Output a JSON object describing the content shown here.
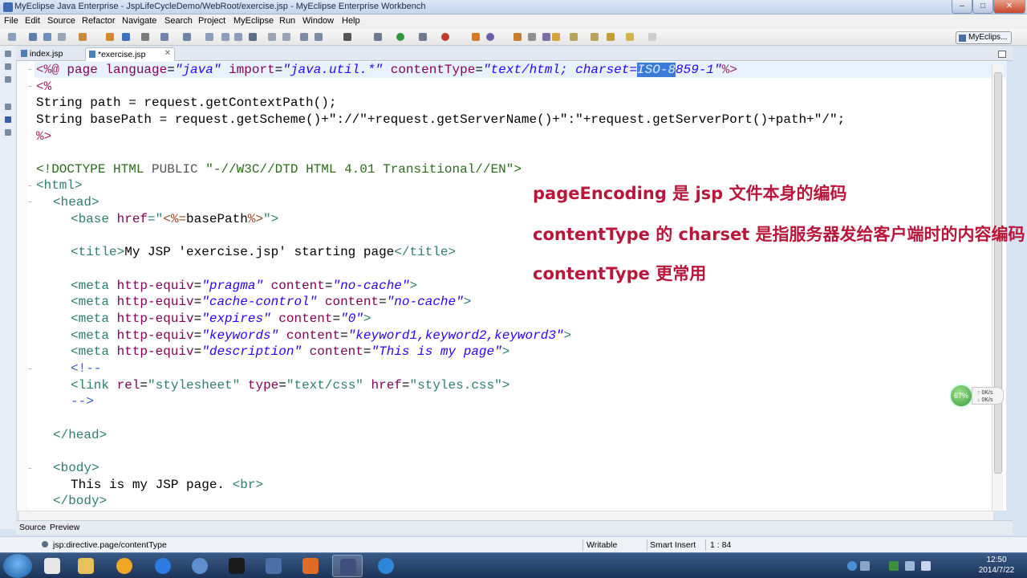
{
  "window": {
    "title": "MyEclipse Java Enterprise - JspLifeCycleDemo/WebRoot/exercise.jsp - MyEclipse Enterprise Workbench"
  },
  "menu": [
    "File",
    "Edit",
    "Source",
    "Refactor",
    "Navigate",
    "Search",
    "Project",
    "MyEclipse",
    "Run",
    "Window",
    "Help"
  ],
  "perspective": {
    "label": "MyEclips..."
  },
  "tabs": [
    {
      "label": "index.jsp"
    },
    {
      "label": "*exercise.jsp"
    }
  ],
  "code": {
    "l1": {
      "open": "<%@ ",
      "kw": "page",
      "a1": "language",
      "v1": "\"java\"",
      "a2": "import",
      "v2": "\"java.util.*\"",
      "a3": "contentType",
      "v3": "\"text/html; charset=",
      "sel": "ISO-8",
      "v3b": "859-1\"",
      "close": "%>"
    },
    "l2": "<%",
    "l3": "String path = request.getContextPath();",
    "l4": "String basePath = request.getScheme()+\"://\"+request.getServerName()+\":\"+request.getServerPort()+path+\"/\";",
    "l5": "%>",
    "l7": {
      "open": "<!",
      "kw": "DOCTYPE HTML",
      "pub": "PUBLIC",
      "str": "\"-//W3C//DTD HTML 4.01 Transitional//EN\"",
      "close": ">"
    },
    "l8": "<html>",
    "l9": "<head>",
    "l10": {
      "open": "<base ",
      "attr": "href",
      "eq": "=\"",
      "jsp1": "<%=",
      "mid": "basePath",
      "jsp2": "%>",
      "close": "\">"
    },
    "l12": {
      "t1": "<title>",
      "text": "My JSP 'exercise.jsp' starting page",
      "t2": "</title>"
    },
    "meta": [
      {
        "open": "<meta ",
        "a1": "http-equiv",
        "v1": "\"pragma\"",
        "a2": "content",
        "v2": "\"no-cache\"",
        "close": ">"
      },
      {
        "open": "<meta ",
        "a1": "http-equiv",
        "v1": "\"cache-control\"",
        "a2": "content",
        "v2": "\"no-cache\"",
        "close": ">"
      },
      {
        "open": "<meta ",
        "a1": "http-equiv",
        "v1": "\"expires\"",
        "a2": "content",
        "v2": "\"0\"",
        "close": ">"
      },
      {
        "open": "<meta ",
        "a1": "http-equiv",
        "v1": "\"keywords\"",
        "a2": "content",
        "v2": "\"keyword1,keyword2,keyword3\"",
        "close": ">"
      },
      {
        "open": "<meta ",
        "a1": "http-equiv",
        "v1": "\"description\"",
        "a2": "content",
        "v2": "\"This is my page\"",
        "close": ">"
      }
    ],
    "l19": "<!--",
    "l20": {
      "open": "<link ",
      "a1": "rel",
      "v1": "\"stylesheet\"",
      "a2": "type",
      "v2": "\"text/css\"",
      "a3": "href",
      "v3": "\"styles.css\"",
      "close": ">"
    },
    "l21": "-->",
    "l23": "</head>",
    "l25": "<body>",
    "l26": {
      "text": "This is my JSP page. ",
      "br": "<br>"
    },
    "l27": "</body>"
  },
  "notes": [
    "pageEncoding 是 jsp 文件本身的编码",
    "contentType 的 charset 是指服务器发给客户端时的内容编码",
    "contentType 更常用"
  ],
  "bottom_tabs": [
    "Source",
    "Preview"
  ],
  "status": {
    "path": "jsp:directive.page/contentType",
    "writable": "Writable",
    "insert": "Smart Insert",
    "position": "1 : 84"
  },
  "netmeter": {
    "percent": "67%",
    "up": "0K/s",
    "down": "0K/s"
  },
  "clock": {
    "time": "12:50",
    "date": "2014/7/22"
  }
}
